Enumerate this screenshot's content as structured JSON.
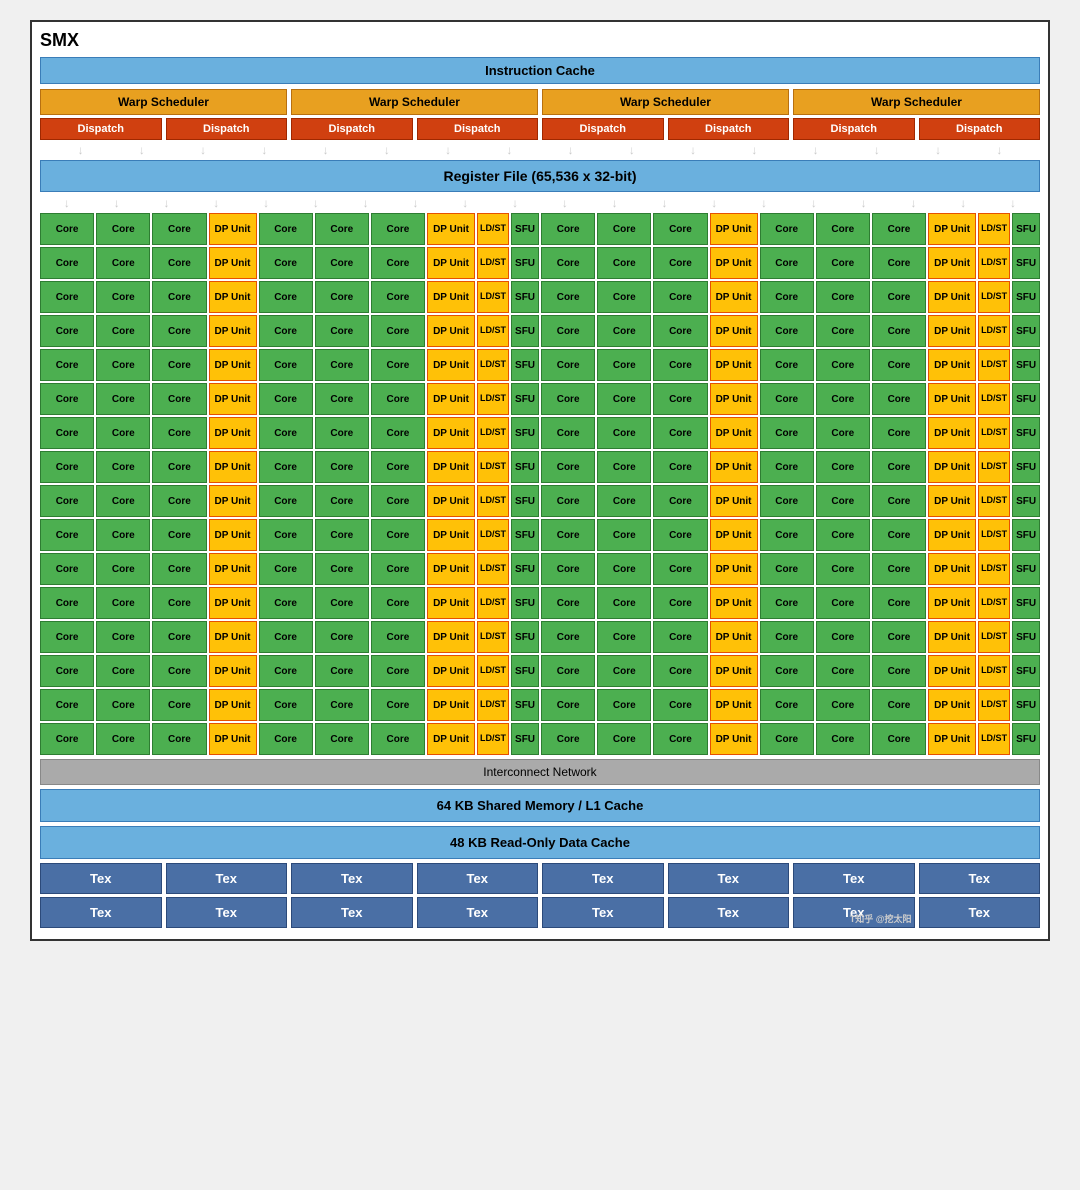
{
  "title": "SMX",
  "instruction_cache": "Instruction Cache",
  "warp_schedulers": [
    "Warp Scheduler",
    "Warp Scheduler",
    "Warp Scheduler",
    "Warp Scheduler"
  ],
  "dispatch_units": [
    "Dispatch",
    "Dispatch",
    "Dispatch",
    "Dispatch",
    "Dispatch",
    "Dispatch",
    "Dispatch",
    "Dispatch"
  ],
  "register_file": "Register File (65,536 x 32-bit)",
  "row_pattern": [
    "Core",
    "Core",
    "Core",
    "DP Unit",
    "Core",
    "Core",
    "Core",
    "DP Unit",
    "LD/ST",
    "SFU",
    "Core",
    "Core",
    "Core",
    "DP Unit",
    "Core",
    "Core",
    "Core",
    "DP Unit",
    "LD/ST",
    "SFU"
  ],
  "num_core_rows": 16,
  "interconnect": "Interconnect Network",
  "shared_memory": "64 KB Shared Memory / L1 Cache",
  "readonly_cache": "48 KB Read-Only Data Cache",
  "tex_units_row1": [
    "Tex",
    "Tex",
    "Tex",
    "Tex",
    "Tex",
    "Tex",
    "Tex",
    "Tex"
  ],
  "tex_units_row2": [
    "Tex",
    "Tex",
    "Tex",
    "Tex",
    "Tex",
    "Tex",
    "T知乎 @挖太阳",
    ""
  ],
  "watermark": "T知乎 @挖太阳"
}
